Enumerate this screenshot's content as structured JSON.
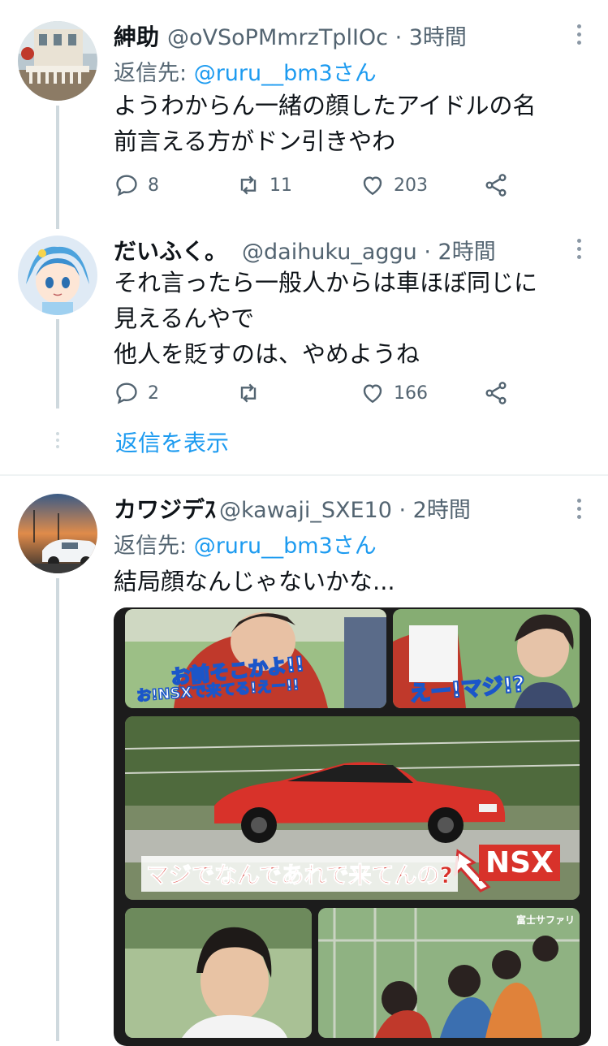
{
  "tweets": [
    {
      "name": "紳助",
      "handle": "@oVSoPMmrzTplIOc · 3時間",
      "reply_label": "返信先: ",
      "reply_mention": "@ruru__bm3さん",
      "text_lines": [
        "ようわからん一緒の顔したアイドルの名",
        "前言える方がドン引きやわ"
      ],
      "replies": "8",
      "retweets": "11",
      "likes": "203"
    },
    {
      "name": "だいふく。",
      "handle": "@daihuku_aggu · 2時間",
      "text_lines": [
        "それ言ったら一般人からは車ほぼ同じに",
        "見えるんやで",
        "他人を貶すのは、やめようね"
      ],
      "replies": "2",
      "retweets": "",
      "likes": "166"
    },
    {
      "name": "カワジデｽ",
      "handle": "@kawaji_SXE10 · 2時間",
      "reply_label": "返信先: ",
      "reply_mention": "@ruru__bm3さん",
      "text_lines": [
        "結局顔なんじゃないかな..."
      ]
    }
  ],
  "show_replies": "返信を表示",
  "media": {
    "captions": {
      "top_left_1": "お前そこかよ!!",
      "top_left_2": "お!NSXで来てる!えー!!",
      "top_right": "えー!マジ!?",
      "middle": "マジでなんであれで来てんの?",
      "nsx_label": "NSX",
      "bottom_right_sign": "富士サファリ"
    }
  },
  "colors": {
    "accent": "#1d9bf0",
    "secondary_text": "#536471",
    "thread_line": "#cfd9de"
  },
  "icons": [
    "reply-icon",
    "retweet-icon",
    "like-icon",
    "share-icon",
    "more-icon"
  ]
}
